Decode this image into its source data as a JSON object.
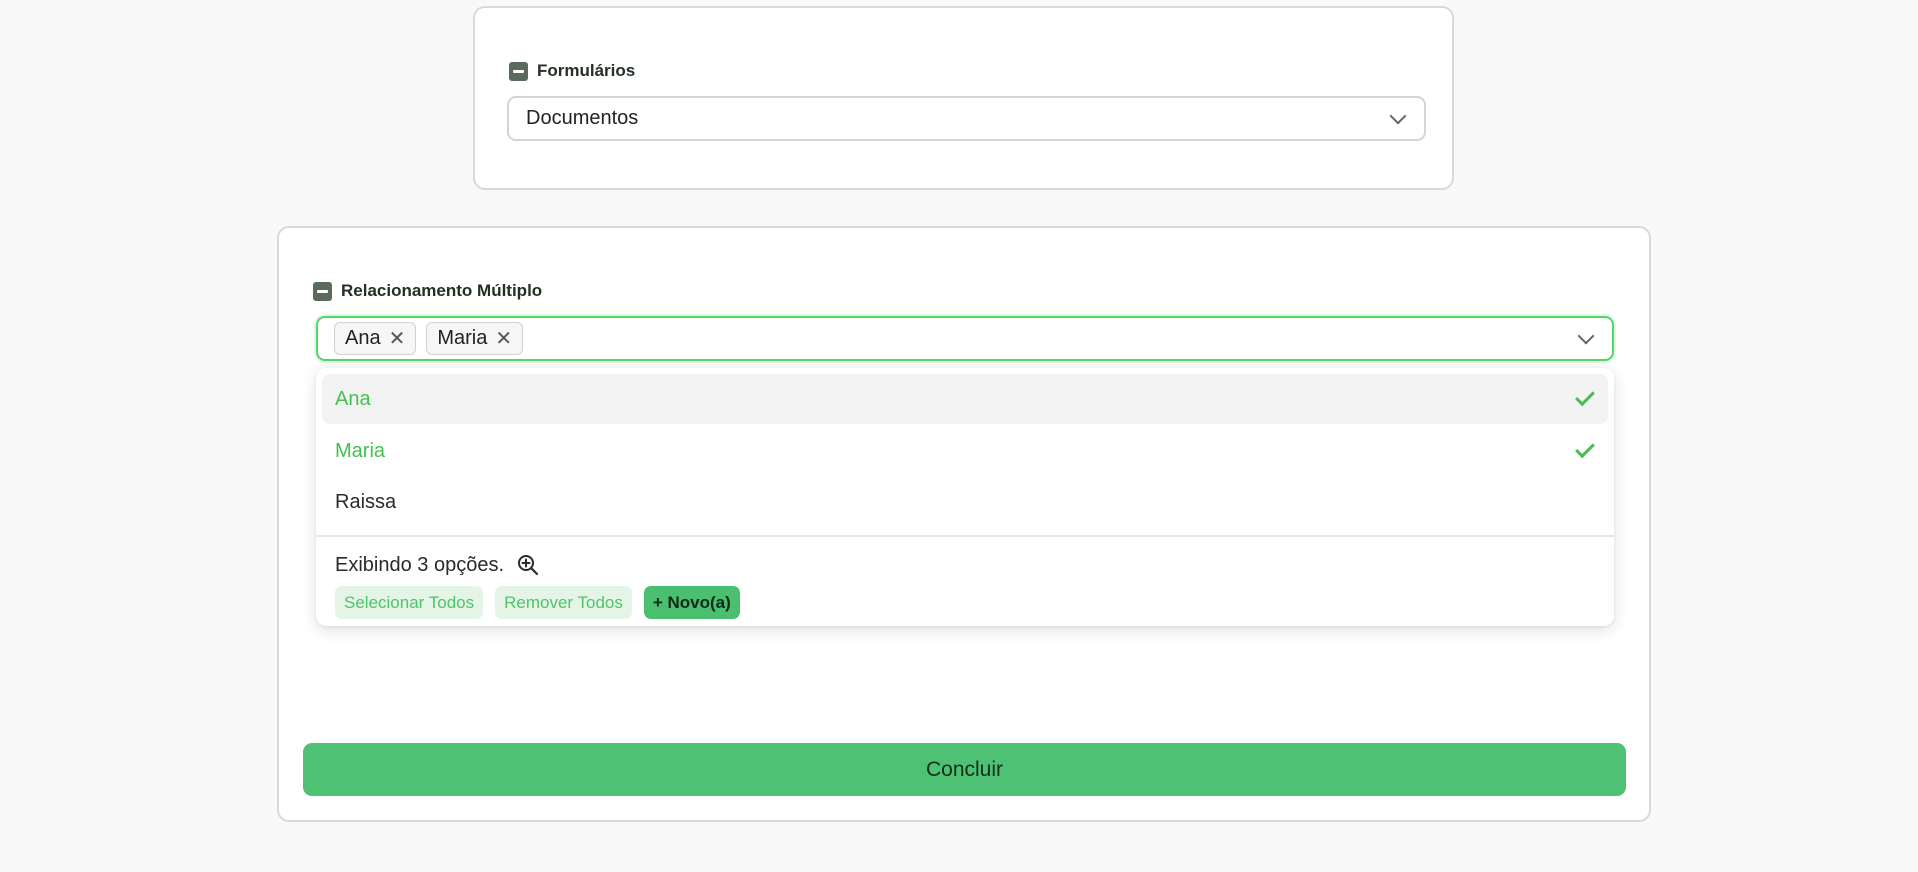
{
  "forms_section": {
    "label": "Formulários",
    "selected_value": "Documentos"
  },
  "relationship_section": {
    "label": "Relacionamento Múltiplo",
    "tags": [
      {
        "label": "Ana",
        "remove_symbol": "✕"
      },
      {
        "label": "Maria",
        "remove_symbol": "✕"
      }
    ],
    "options": [
      {
        "label": "Ana",
        "selected": true
      },
      {
        "label": "Maria",
        "selected": true
      },
      {
        "label": "Raissa",
        "selected": false
      }
    ],
    "footer_text": "Exibindo 3 opções.",
    "select_all_label": "Selecionar Todos",
    "remove_all_label": "Remover Todos",
    "new_label": "+ Novo(a)"
  },
  "conclude_label": "Concluir",
  "colors": {
    "accent": "#44c04f",
    "button": "#4fc175",
    "focus_border": "#57d46a"
  },
  "icons": {
    "collapse": "minus-square-icon",
    "dropdown": "chevron-down-icon",
    "check": "check-icon",
    "zoom": "zoom-in-icon"
  }
}
